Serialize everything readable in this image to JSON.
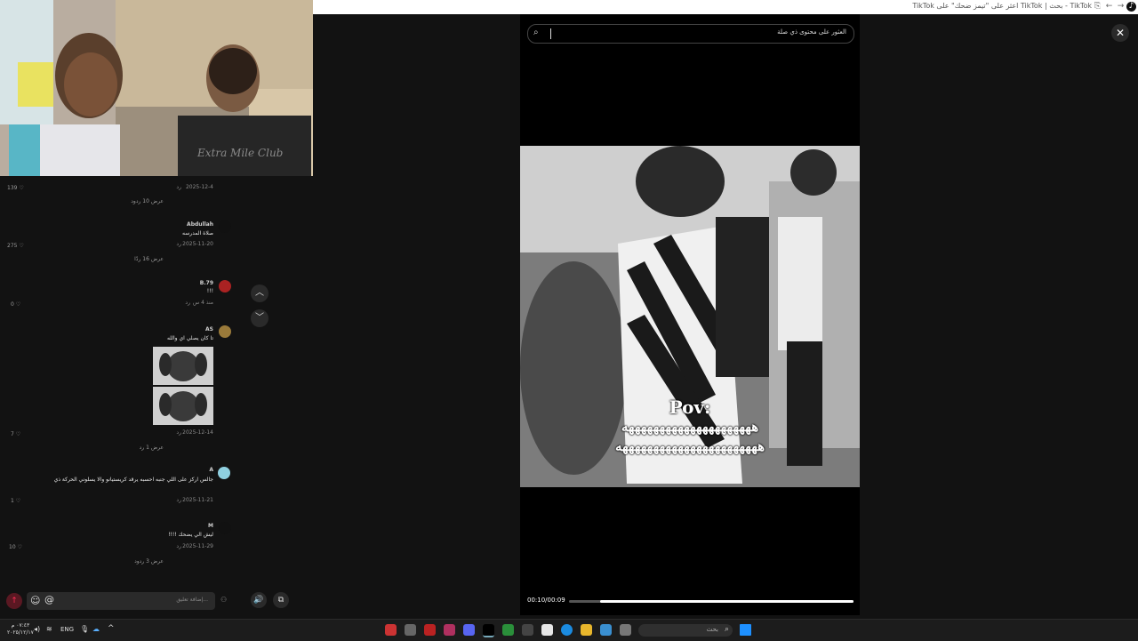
{
  "browser": {
    "tab_title": "TikTok - بحث | TikTok اعثر على \"تيمز ضحك\" على TikTok"
  },
  "search": {
    "query": "العثور على محتوى ذي صلة"
  },
  "player": {
    "time": "00:10/00:09",
    "progress": 0.89,
    "caption_title": "Pov:",
    "caption_line1": "هههههههههههههههههههههه",
    "caption_line2": "هههههههههههههههههههههههه"
  },
  "comments": [
    {
      "name": "",
      "text": "",
      "date": "2025-12-4",
      "reply": "رد",
      "likes": "139 ♡",
      "more": "عرض 10 ردود"
    },
    {
      "name": "Abdullah",
      "text": "صلاة المدرسه",
      "date": "2025-11-20",
      "reply": "رد",
      "likes": "275 ♡",
      "more": "عرض 16 ردًا"
    },
    {
      "name": "B.79",
      "text": "!!!",
      "date": "منذ 4 س",
      "reply": "رد",
      "likes": "0 ♡",
      "more": ""
    },
    {
      "name": "AS",
      "text": "تا كان يصلي اي والله",
      "date": "2025-12-14",
      "reply": "رد",
      "likes": "7 ♡",
      "more": "عرض 1 رد"
    },
    {
      "name": "A",
      "text": "جالس اركز على اللي جنبه احسبه يرقد كريستيانو والا يسلوني الحركة ذي",
      "date": "2025-11-21",
      "reply": "رد",
      "likes": "1 ♡",
      "more": ""
    },
    {
      "name": "M",
      "text": "ليش الي يضحك !!!!",
      "date": "2025-11-29",
      "reply": "رد",
      "likes": "10 ♡",
      "more": "عرض 3 ردود"
    }
  ],
  "composer": {
    "placeholder": "إضافة تعليق..."
  },
  "taskbar": {
    "time": "٠٧:٤٣ م",
    "date": "٢٠٢٥/١٢/١٧",
    "lang": "ENG",
    "search_label": "بحث"
  },
  "colors": {
    "accent": "#fe2c55",
    "progress": "#ffffff"
  }
}
